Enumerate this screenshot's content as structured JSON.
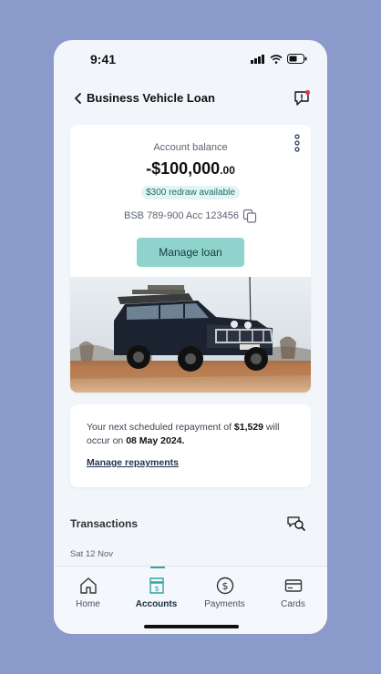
{
  "status_bar": {
    "time": "9:41"
  },
  "header": {
    "title": "Business Vehicle Loan"
  },
  "account": {
    "balance_label": "Account balance",
    "balance_main": "-$100,000",
    "balance_cents": ".00",
    "redraw": "$300 redraw available",
    "bsb": "BSB 789-900 Acc 123456",
    "manage_button": "Manage loan"
  },
  "repayment": {
    "text_before": "Your next scheduled repayment of ",
    "amount": "$1,529",
    "text_middle": " will occur on ",
    "date": "08 May 2024.",
    "link": "Manage repayments"
  },
  "transactions": {
    "title": "Transactions",
    "date_header": "Sat 12 Nov"
  },
  "tabs": [
    {
      "label": "Home",
      "icon": "home-icon"
    },
    {
      "label": "Accounts",
      "icon": "bank-icon"
    },
    {
      "label": "Payments",
      "icon": "dollar-circle-icon"
    },
    {
      "label": "Cards",
      "icon": "card-icon"
    }
  ],
  "active_tab": "Accounts",
  "colors": {
    "background": "#8a9bcb",
    "accent": "#8ed4cc",
    "redraw_badge": "#e2f5f4",
    "active_indicator": "#2ea6a0"
  }
}
